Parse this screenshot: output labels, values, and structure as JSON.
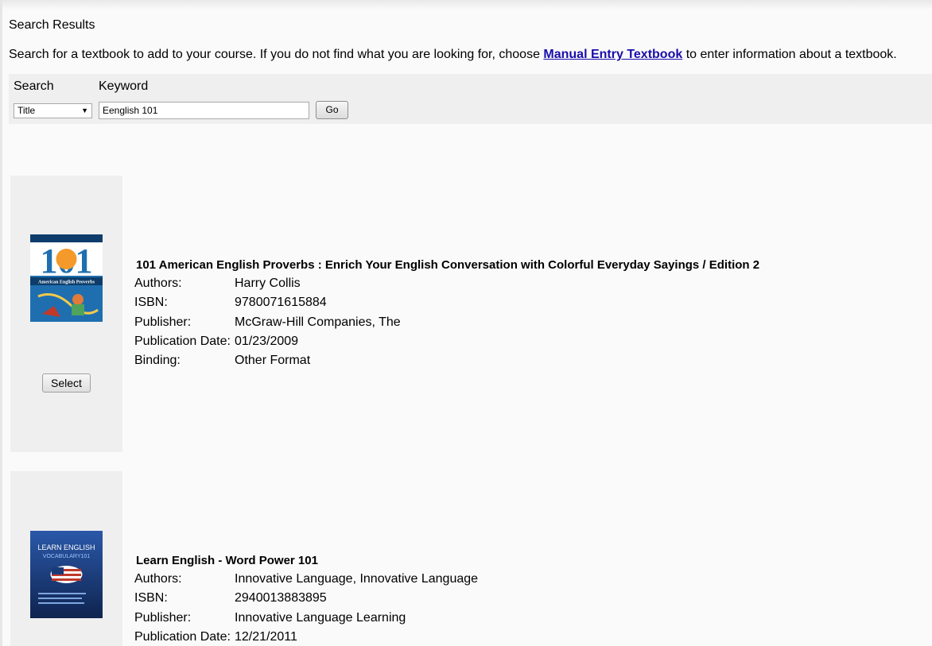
{
  "heading": "Search Results",
  "intro": {
    "before": "Search for a textbook to add to your course. If you do not find what you are looking for, choose ",
    "link": "Manual Entry Textbook",
    "after": " to enter information about a textbook."
  },
  "search": {
    "search_label": "Search",
    "keyword_label": "Keyword",
    "field_selected": "Title",
    "keyword_value": "Eenglish 101",
    "go_label": "Go"
  },
  "field_labels": {
    "authors": "Authors:",
    "isbn": "ISBN:",
    "publisher": "Publisher:",
    "publication_date": "Publication Date:",
    "binding": "Binding:"
  },
  "results": [
    {
      "title": "101 American English Proverbs : Enrich Your English Conversation with Colorful Everyday Sayings / Edition 2",
      "authors": "Harry Collis",
      "isbn": "9780071615884",
      "publisher": "McGraw-Hill Companies, The",
      "publication_date": "01/23/2009",
      "binding": "Other Format",
      "select_label": "Select",
      "cover": {
        "big_text": "101",
        "subtitle": "American English Proverbs",
        "color": "#1f6fb0"
      }
    },
    {
      "title": "Learn English - Word Power 101",
      "authors": "Innovative Language, Innovative Language",
      "isbn": "2940013883895",
      "publisher": "Innovative Language Learning",
      "publication_date": "12/21/2011",
      "cover": {
        "line1": "LEARN ENGLISH",
        "line2": "VOCABULARY101",
        "color": "#1b3b78"
      }
    }
  ]
}
